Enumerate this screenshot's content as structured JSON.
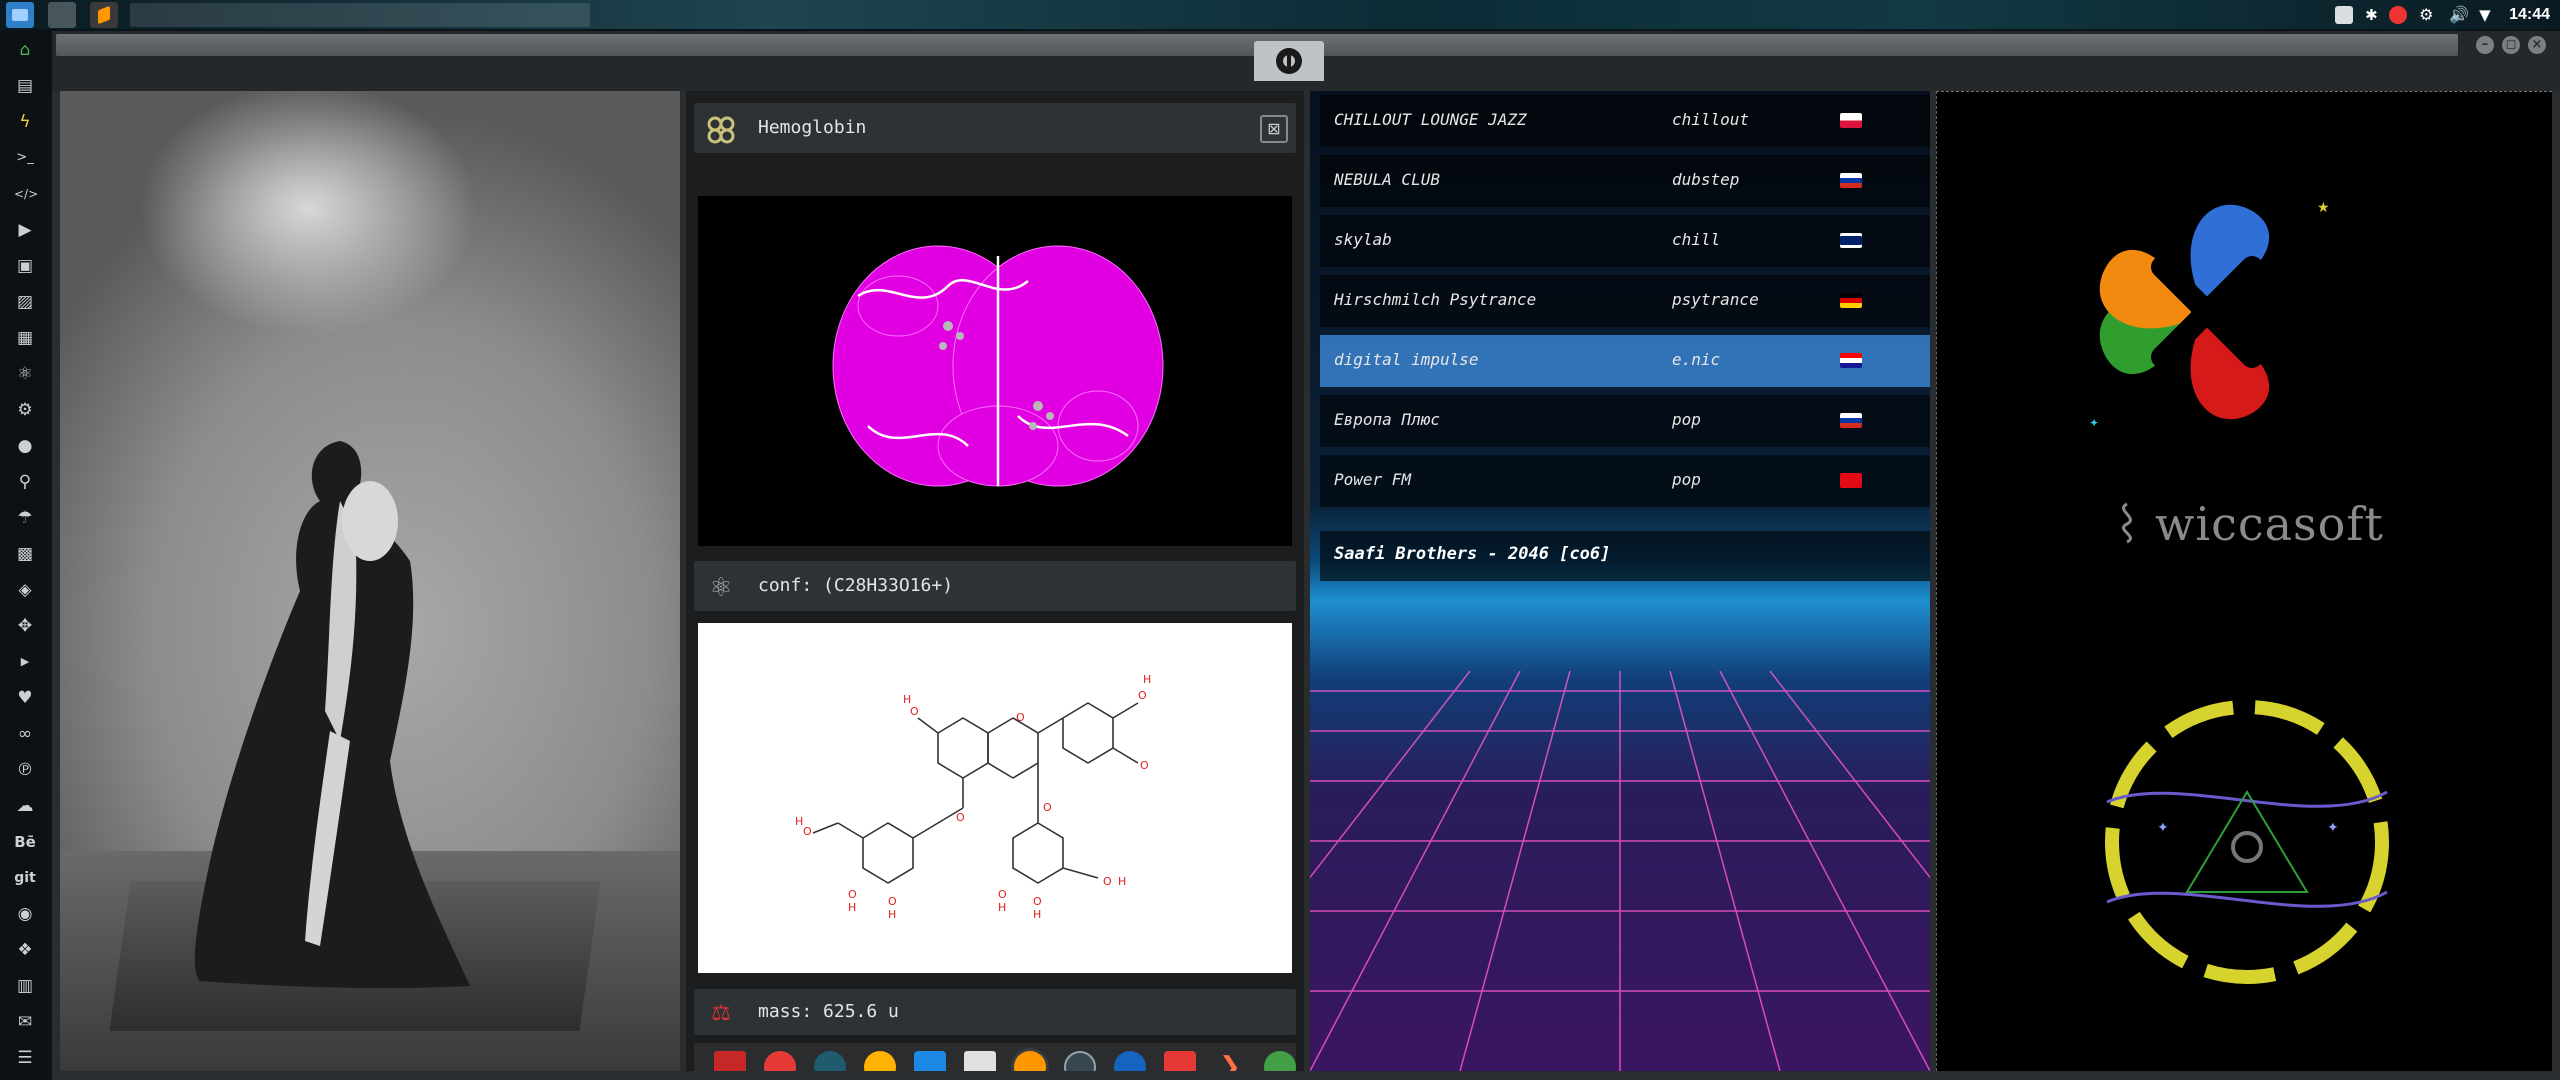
{
  "system": {
    "clock": "14:44"
  },
  "molecule": {
    "name": "Hemoglobin",
    "formula_label": "conf: (C28H33O16+)",
    "mass_label": "mass: 625.6 u"
  },
  "radio": {
    "stations": [
      {
        "name": "CHILLOUT LOUNGE JAZZ",
        "genre": "chillout",
        "flag": "pl",
        "selected": false
      },
      {
        "name": "NEBULA CLUB",
        "genre": "dubstep",
        "flag": "ru",
        "selected": false
      },
      {
        "name": "skylab",
        "genre": "chill",
        "flag": "uk",
        "selected": false
      },
      {
        "name": "Hirschmilch Psytrance",
        "genre": "psytrance",
        "flag": "de",
        "selected": false
      },
      {
        "name": "digital impulse",
        "genre": "e.nic",
        "flag": "hr",
        "selected": true
      },
      {
        "name": "Европа Плюс",
        "genre": "pop",
        "flag": "ru",
        "selected": false
      },
      {
        "name": "Power FM",
        "genre": "pop",
        "flag": "tr",
        "selected": false
      }
    ],
    "now_playing": "Saafi Brothers - 2046 [со6]"
  },
  "branding": {
    "wiccasoft": "wiccasoft"
  },
  "colors": {
    "magenta": "#e100e1",
    "radio_selected": "#3c8cdc",
    "emblem_yellow": "#d6d22e",
    "logo_green": "#2f9e2f",
    "logo_blue": "#2f6fd6",
    "logo_orange": "#f28a10",
    "logo_red": "#d61a1a"
  }
}
